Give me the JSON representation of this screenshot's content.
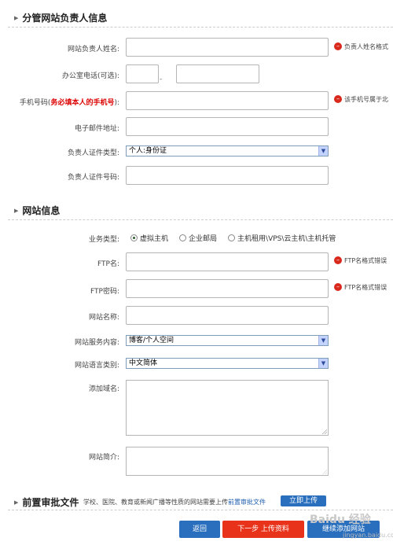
{
  "section1": {
    "title": "分管网站负责人信息"
  },
  "section2": {
    "title": "网站信息"
  },
  "section3": {
    "title": "前置审批文件",
    "note_prefix": "学校、医院、教育或新闻广播等性质的网站需要上传",
    "note_link": "前置审批文件",
    "upload_button": "立即上传"
  },
  "fields": {
    "owner_name": "网站负责人姓名:",
    "office_phone": "办公室电话(可选):",
    "mobile_prefix": "手机号码(",
    "mobile_required": "务必填本人的手机号",
    "mobile_suffix": "):",
    "email": "电子邮件地址:",
    "id_type": "负责人证件类型:",
    "id_type_value": "个人:身份证",
    "id_number": "负责人证件号码:",
    "business_type": "业务类型:",
    "ftp_name": "FTP名:",
    "ftp_password": "FTP密码:",
    "site_name": "网站名称:",
    "service_content": "网站服务内容:",
    "service_content_value": "博客/个人空间",
    "language": "网站语言类别:",
    "language_value": "中文简体",
    "add_domain": "添加域名:",
    "site_intro": "网站简介:"
  },
  "radios": [
    "虚拟主机",
    "企业邮局",
    "主机租用\\VPS\\云主机\\主机托管"
  ],
  "errors": {
    "owner_name": "负责人姓名格式",
    "mobile": "该手机号属于北",
    "ftp_name": "FTP名格式错误",
    "ftp_password": "FTP名格式错误"
  },
  "buttons": {
    "back": "返回",
    "next": "下一步  上传资料",
    "continue": "继续添加网站"
  },
  "watermark": {
    "main": "Baidu 经验",
    "sub": "jingyan.baidu.com"
  }
}
